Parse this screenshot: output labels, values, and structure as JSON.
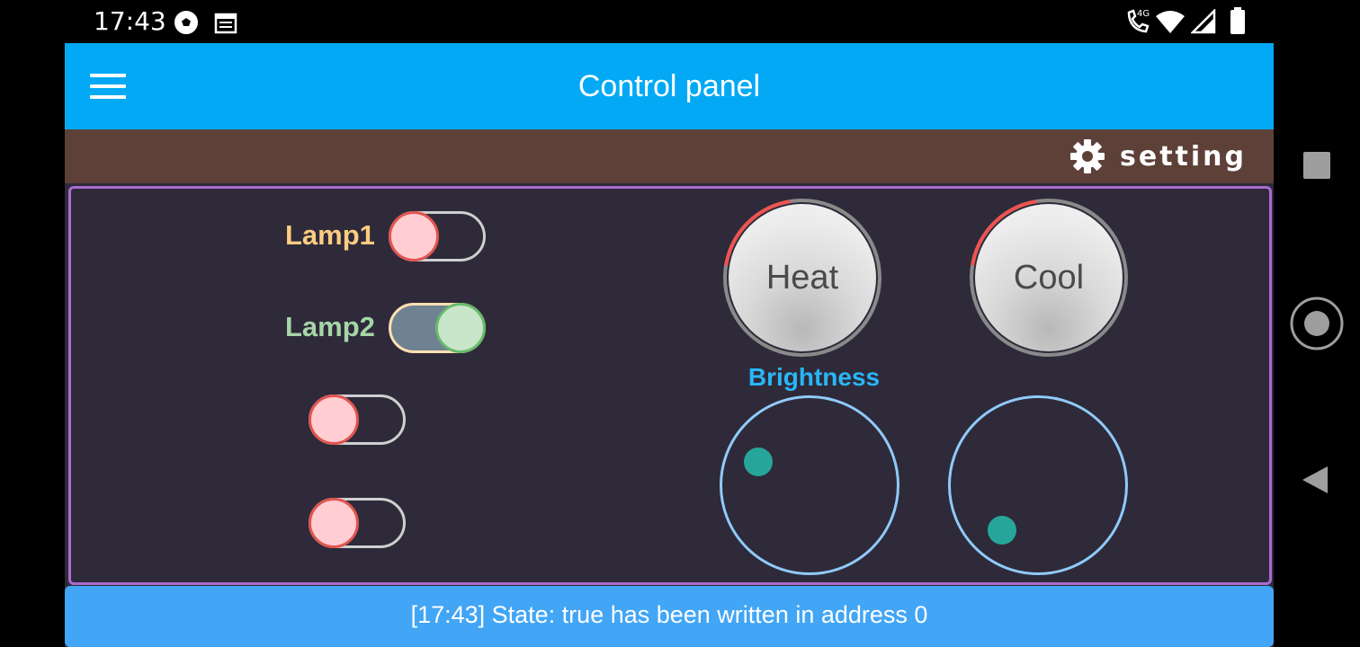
{
  "status_bar": {
    "time": "17:43",
    "icons": [
      "soccer-ball-icon",
      "calendar-icon",
      "call-4g-icon",
      "wifi-icon",
      "signal-icon",
      "battery-icon"
    ]
  },
  "appbar": {
    "title": "Control panel",
    "menu_icon": "hamburger-menu-icon"
  },
  "setting_bar": {
    "label": "setting",
    "icon": "gear-icon"
  },
  "switches": [
    {
      "label": "Lamp1",
      "state": "off",
      "label_color": "#ffcc80"
    },
    {
      "label": "Lamp2",
      "state": "on",
      "label_color": "#a5d6a7"
    },
    {
      "label": "",
      "state": "off"
    },
    {
      "label": "",
      "state": "off"
    }
  ],
  "knobs": [
    {
      "label": "Heat",
      "level": 0.2
    },
    {
      "label": "Cool",
      "level": 0.2
    }
  ],
  "brightness": {
    "title": "Brightness"
  },
  "log": {
    "message": "[17:43] State: true has been written in address 0"
  },
  "colors": {
    "appbar": "#03a9f4",
    "setting_bar": "#5d4037",
    "panel_bg": "#2e2a3a",
    "panel_border": "#ab6bd0",
    "log_bar": "#42a5f5",
    "accent_red": "#ef5350",
    "joystick_dot": "#26a69a",
    "brightness_title": "#29b6f6"
  }
}
